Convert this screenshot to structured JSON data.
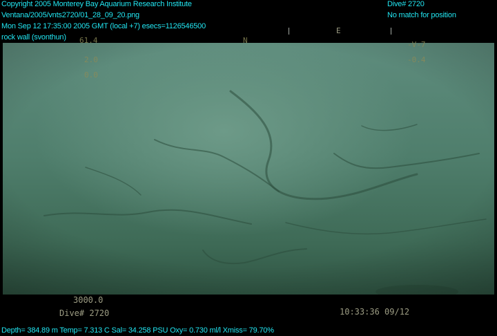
{
  "hud_top_left": {
    "copyright": "Copyright 2005 Monterey Bay Aquarium Research Institute",
    "file_path": "Ventana/2005/vnts2720/01_28_09_20.png",
    "timestamp": "Mon Sep 12 17:35:00 2005 GMT (local +7)  esecs=1126546500",
    "annotation": "rock wall (svonthun)"
  },
  "hud_top_right": {
    "dive": "Dive# 2720",
    "position_status": "No match for position"
  },
  "camera_overlay": {
    "heading_value": "61.4",
    "heading_n": "N",
    "heading_e": "E",
    "left_value_1": "2.0",
    "left_value_2": "0.0",
    "right_value_1": "-V-7",
    "right_value_2": "-0.4",
    "depth_counter": "3000.0",
    "dive_label": "Dive# 2720",
    "clock": "10:33:36 09/12"
  },
  "hud_bottom": {
    "sensors": "Depth= 384.89 m  Temp= 7.313 C  Sal= 34.258 PSU  Oxy= 0.730 ml/l  Xmiss= 79.70%"
  },
  "colors": {
    "hud_text": "#22e6f2",
    "camera_text": "#8c8a58",
    "water": "#4f7e6c"
  }
}
